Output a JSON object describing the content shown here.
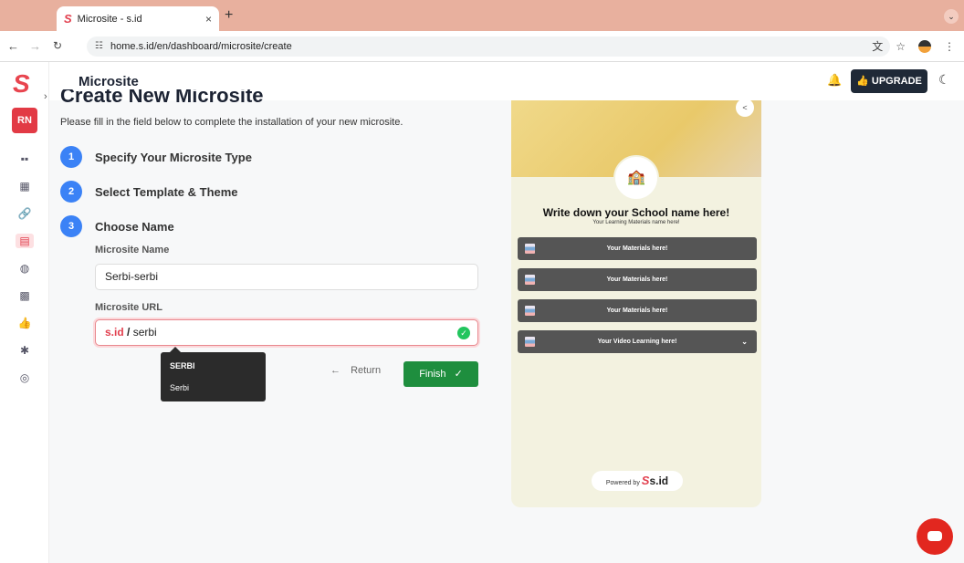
{
  "browser": {
    "tab_title": "Microsite - s.id",
    "tab_close": "×",
    "new_tab": "+",
    "url": "home.s.id/en/dashboard/microsite/create"
  },
  "sidebar": {
    "logo": "S",
    "avatar": "RN"
  },
  "header": {
    "title": "Microsite",
    "upgrade_label": "UPGRADE"
  },
  "form": {
    "page_title": "Create New Microsite",
    "subtitle": "Please fill in the field below to complete the installation of your new microsite.",
    "steps": [
      {
        "num": "1",
        "label": "Specify Your Microsite Type"
      },
      {
        "num": "2",
        "label": "Select Template & Theme"
      },
      {
        "num": "3",
        "label": "Choose Name"
      }
    ],
    "name_label": "Microsite Name",
    "name_value": "Serbi-serbi",
    "url_label": "Microsite URL",
    "url_prefix": "s.id",
    "url_sep": " / ",
    "url_value": "serbi",
    "suggestions": [
      "SERBI",
      "Serbi"
    ],
    "return_label": "Return",
    "finish_label": "Finish"
  },
  "preview": {
    "title": "Write down your School name here!",
    "subtitle": "Your Learning Materials name here!",
    "items": [
      "Your Materials here!",
      "Your Materials here!",
      "Your Materials here!",
      "Your Video Learning here!"
    ],
    "powered_by": "Powered by",
    "brand": "s.id",
    "brand_s": "S"
  },
  "colors": {
    "brand_red": "#e2404f",
    "step_blue": "#3b82f6",
    "finish_green": "#1e8e3e",
    "upgrade_dark": "#1f2937"
  }
}
